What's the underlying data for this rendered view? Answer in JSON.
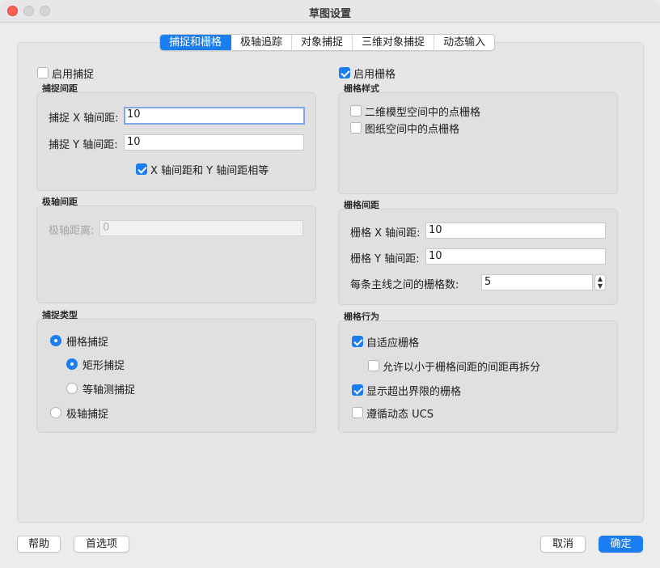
{
  "window": {
    "title": "草图设置"
  },
  "tabs": [
    {
      "label": "捕捉和栅格",
      "active": true
    },
    {
      "label": "极轴追踪",
      "active": false
    },
    {
      "label": "对象捕捉",
      "active": false
    },
    {
      "label": "三维对象捕捉",
      "active": false
    },
    {
      "label": "动态输入",
      "active": false
    }
  ],
  "snap": {
    "enable_label": "启用捕捉",
    "enabled": false,
    "spacing_title": "捕捉间距",
    "x_label": "捕捉 X 轴间距:",
    "x_value": "10",
    "y_label": "捕捉 Y 轴间距:",
    "y_value": "10",
    "equal_label": "X 轴间距和 Y 轴间距相等",
    "equal_checked": true
  },
  "polar": {
    "title": "极轴间距",
    "distance_label": "极轴距离:",
    "distance_value": "0"
  },
  "snap_type": {
    "title": "捕捉类型",
    "grid_snap": "栅格捕捉",
    "rect_snap": "矩形捕捉",
    "iso_snap": "等轴测捕捉",
    "polar_snap": "极轴捕捉"
  },
  "grid": {
    "enable_label": "启用栅格",
    "enabled": true,
    "style_title": "栅格样式",
    "style_2d": "二维模型空间中的点栅格",
    "style_paper": "图纸空间中的点栅格",
    "spacing_title": "栅格间距",
    "x_label": "栅格 X 轴间距:",
    "x_value": "10",
    "y_label": "栅格 Y 轴间距:",
    "y_value": "10",
    "major_label": "每条主线之间的栅格数:",
    "major_value": "5",
    "behavior_title": "栅格行为",
    "adaptive": "自适应栅格",
    "subdivide": "允许以小于栅格间距的间距再拆分",
    "beyond_limits": "显示超出界限的栅格",
    "follow_ucs": "遵循动态 UCS"
  },
  "buttons": {
    "help": "帮助",
    "options": "首选项",
    "cancel": "取消",
    "ok": "确定"
  },
  "colors": {
    "accent": "#1a7df0",
    "close": "#fe5f57"
  }
}
